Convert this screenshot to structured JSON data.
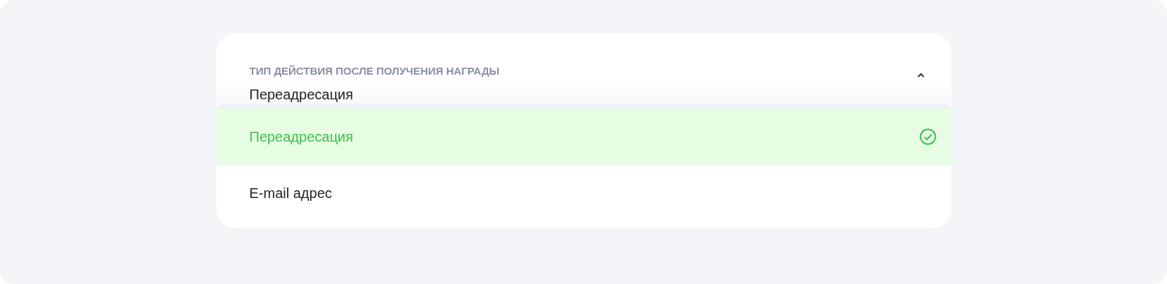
{
  "select": {
    "label": "ТИП ДЕЙСТВИЯ ПОСЛЕ ПОЛУЧЕНИЯ НАГРАДЫ",
    "value": "Переадресация",
    "expanded": true
  },
  "options": [
    {
      "label": "Переадресация",
      "selected": true
    },
    {
      "label": "E-mail адрес",
      "selected": false
    }
  ]
}
